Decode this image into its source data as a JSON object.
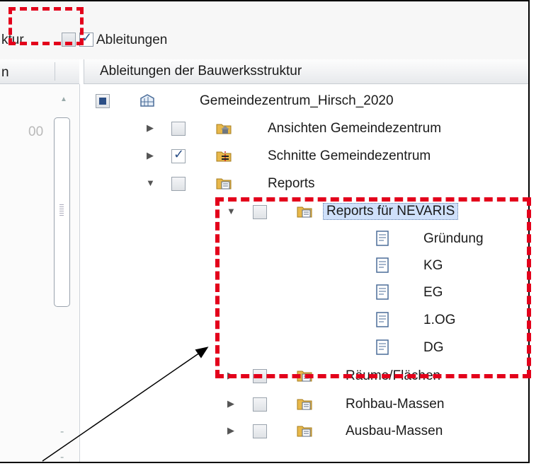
{
  "toolbar": {
    "left_label_cut": "ktur",
    "check_label": "Ableitungen"
  },
  "left_pane": {
    "header_cut": "n",
    "value_cut": "00"
  },
  "tree": {
    "header": "Ableitungen der Bauwerksstruktur",
    "root": "Gemeindezentrum_Hirsch_2020",
    "items": {
      "ansichten": "Ansichten Gemeindezentrum",
      "schnitte": "Schnitte Gemeindezentrum",
      "reports": "Reports",
      "reports_nevaris": "Reports für NEVARIS",
      "gruendung": "Gründung",
      "kg": "KG",
      "eg": "EG",
      "og1": "1.OG",
      "dg": "DG",
      "raeume": "Räume/Flächen",
      "rohbau": "Rohbau-Massen",
      "ausbau": "Ausbau-Massen"
    }
  },
  "colors": {
    "annotation_red": "#e3001b",
    "selection_bg": "#cfe0fa",
    "folder": "#e8b84a"
  }
}
